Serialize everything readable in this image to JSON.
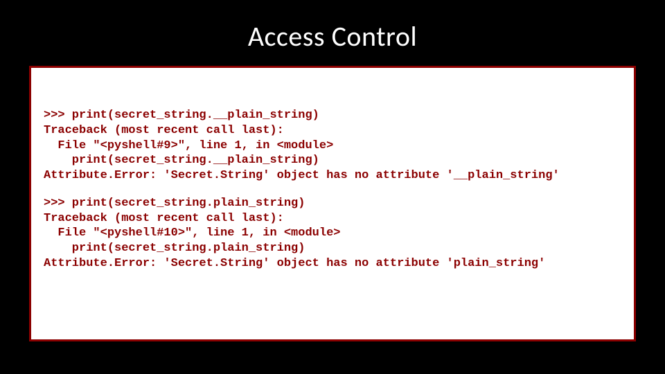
{
  "title": "Access Control",
  "code_blocks": [
    ">>> print(secret_string.__plain_string)\nTraceback (most recent call last):\n  File \"<pyshell#9>\", line 1, in <module>\n    print(secret_string.__plain_string)\nAttribute.Error: 'Secret.String' object has no attribute '__plain_string'",
    ">>> print(secret_string.plain_string)\nTraceback (most recent call last):\n  File \"<pyshell#10>\", line 1, in <module>\n    print(secret_string.plain_string)\nAttribute.Error: 'Secret.String' object has no attribute 'plain_string'"
  ]
}
